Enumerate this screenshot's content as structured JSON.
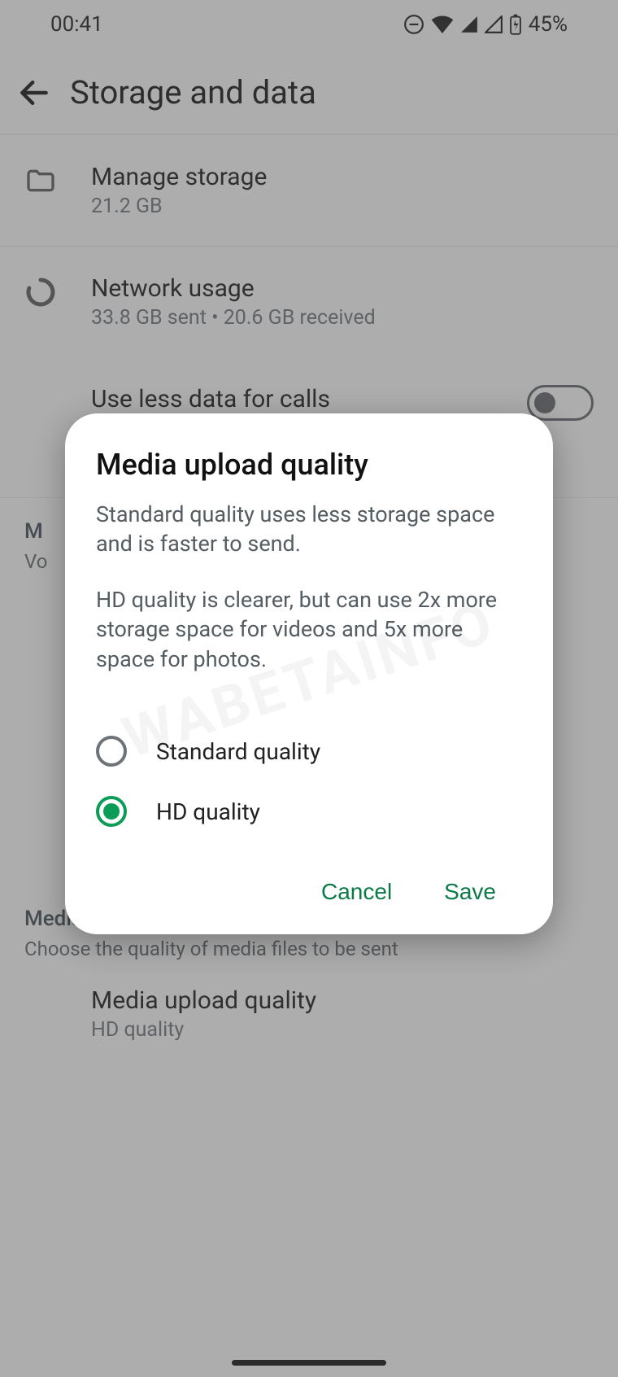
{
  "status": {
    "time": "00:41",
    "battery_pct": "45%"
  },
  "appbar": {
    "title": "Storage and data"
  },
  "rows": {
    "manage_storage": {
      "title": "Manage storage",
      "sub": "21.2 GB"
    },
    "network_usage": {
      "title": "Network usage",
      "sub": "33.8 GB sent • 20.6 GB received"
    },
    "use_less_data": {
      "title": "Use less data for calls"
    }
  },
  "section_auto": {
    "header_first_letter": "M",
    "caption_prefix": "Vo"
  },
  "section_media_quality": {
    "header": "Media quality",
    "caption": "Choose the quality of media files to be sent"
  },
  "media_upload_row": {
    "title": "Media upload quality",
    "sub": "HD quality"
  },
  "dialog": {
    "title": "Media upload quality",
    "body1": "Standard quality uses less storage space and is faster to send.",
    "body2": "HD quality is clearer, but can use 2x more storage space for videos and 5x more space for photos.",
    "option_standard": "Standard quality",
    "option_hd": "HD quality",
    "cancel": "Cancel",
    "save": "Save",
    "selected": "hd"
  },
  "watermark": "WABETAINFO"
}
